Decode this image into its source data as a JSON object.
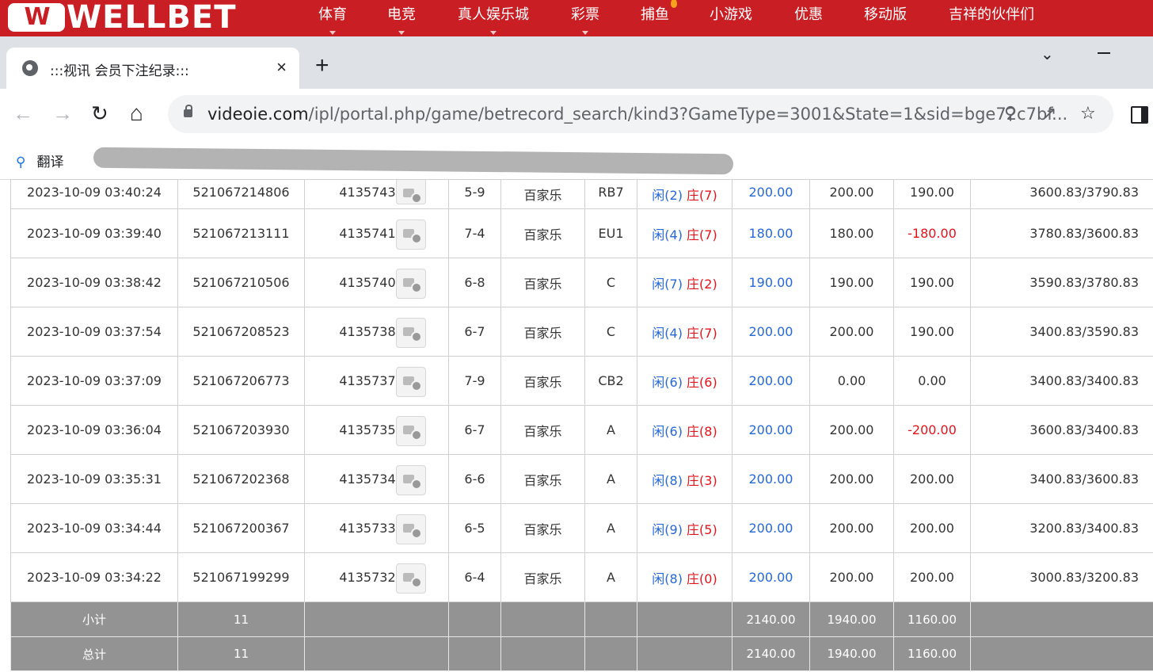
{
  "site": {
    "logo_mark": "W",
    "logo_text": "WELLBET",
    "nav": [
      {
        "label": "体育",
        "caret": true
      },
      {
        "label": "电竞",
        "caret": true
      },
      {
        "label": "真人娱乐城",
        "caret": true
      },
      {
        "label": "彩票",
        "caret": true
      },
      {
        "label": "捕鱼",
        "caret": false
      },
      {
        "label": "小游戏",
        "caret": false
      },
      {
        "label": "优惠",
        "caret": false
      },
      {
        "label": "移动版",
        "caret": false
      },
      {
        "label": "吉祥的伙伴们",
        "caret": false
      }
    ]
  },
  "browser": {
    "tab_title": ":::视讯 会员下注纪录:::",
    "tab_close": "×",
    "new_tab": "+",
    "url_host": "videoie.com",
    "url_path": "/ipl/portal.php/game/betrecord_search/kind3?GameType=3001&State=1&sid=bge72c7bf...",
    "bookmark_translate": "翻译"
  },
  "table": {
    "rows": [
      {
        "time": "2023-10-09 03:40:24",
        "order_no": "521067214806",
        "bet_no": "413574327",
        "round": "5-9",
        "game": "百家乐",
        "table": "RB7",
        "player": "闲(2)",
        "banker": "庄(7)",
        "bet": "200.00",
        "valid": "200.00",
        "result": "190.00",
        "result_negative": false,
        "balance": "3600.83/3790.83"
      },
      {
        "time": "2023-10-09 03:39:40",
        "order_no": "521067213111",
        "bet_no": "413574193",
        "round": "7-4",
        "game": "百家乐",
        "table": "EU1",
        "player": "闲(4)",
        "banker": "庄(7)",
        "bet": "180.00",
        "valid": "180.00",
        "result": "-180.00",
        "result_negative": true,
        "balance": "3780.83/3600.83"
      },
      {
        "time": "2023-10-09 03:38:42",
        "order_no": "521067210506",
        "bet_no": "413574018",
        "round": "6-8",
        "game": "百家乐",
        "table": "C",
        "player": "闲(7)",
        "banker": "庄(2)",
        "bet": "190.00",
        "valid": "190.00",
        "result": "190.00",
        "result_negative": false,
        "balance": "3590.83/3780.83"
      },
      {
        "time": "2023-10-09 03:37:54",
        "order_no": "521067208523",
        "bet_no": "413573891",
        "round": "6-7",
        "game": "百家乐",
        "table": "C",
        "player": "闲(4)",
        "banker": "庄(7)",
        "bet": "200.00",
        "valid": "200.00",
        "result": "190.00",
        "result_negative": false,
        "balance": "3400.83/3590.83"
      },
      {
        "time": "2023-10-09 03:37:09",
        "order_no": "521067206773",
        "bet_no": "413573724",
        "round": "7-9",
        "game": "百家乐",
        "table": "CB2",
        "player": "闲(6)",
        "banker": "庄(6)",
        "bet": "200.00",
        "valid": "0.00",
        "result": "0.00",
        "result_negative": false,
        "balance": "3400.83/3400.83"
      },
      {
        "time": "2023-10-09 03:36:04",
        "order_no": "521067203930",
        "bet_no": "413573560",
        "round": "6-7",
        "game": "百家乐",
        "table": "A",
        "player": "闲(6)",
        "banker": "庄(8)",
        "bet": "200.00",
        "valid": "200.00",
        "result": "-200.00",
        "result_negative": true,
        "balance": "3600.83/3400.83"
      },
      {
        "time": "2023-10-09 03:35:31",
        "order_no": "521067202368",
        "bet_no": "413573456",
        "round": "6-6",
        "game": "百家乐",
        "table": "A",
        "player": "闲(8)",
        "banker": "庄(3)",
        "bet": "200.00",
        "valid": "200.00",
        "result": "200.00",
        "result_negative": false,
        "balance": "3400.83/3600.83"
      },
      {
        "time": "2023-10-09 03:34:44",
        "order_no": "521067200367",
        "bet_no": "413573325",
        "round": "6-5",
        "game": "百家乐",
        "table": "A",
        "player": "闲(9)",
        "banker": "庄(5)",
        "bet": "200.00",
        "valid": "200.00",
        "result": "200.00",
        "result_negative": false,
        "balance": "3200.83/3400.83"
      },
      {
        "time": "2023-10-09 03:34:22",
        "order_no": "521067199299",
        "bet_no": "413573224",
        "round": "6-4",
        "game": "百家乐",
        "table": "A",
        "player": "闲(8)",
        "banker": "庄(0)",
        "bet": "200.00",
        "valid": "200.00",
        "result": "200.00",
        "result_negative": false,
        "balance": "3000.83/3200.83"
      }
    ],
    "subtotal": {
      "label": "小计",
      "count": "11",
      "bet": "2140.00",
      "valid": "1940.00",
      "result": "1160.00"
    },
    "total": {
      "label": "总计",
      "count": "11",
      "bet": "2140.00",
      "valid": "1940.00",
      "result": "1160.00"
    }
  },
  "colors": {
    "brand_red": "#c81e24",
    "player_blue": "#2668d8",
    "banker_red": "#e3141c",
    "summary_gray": "#939393"
  }
}
